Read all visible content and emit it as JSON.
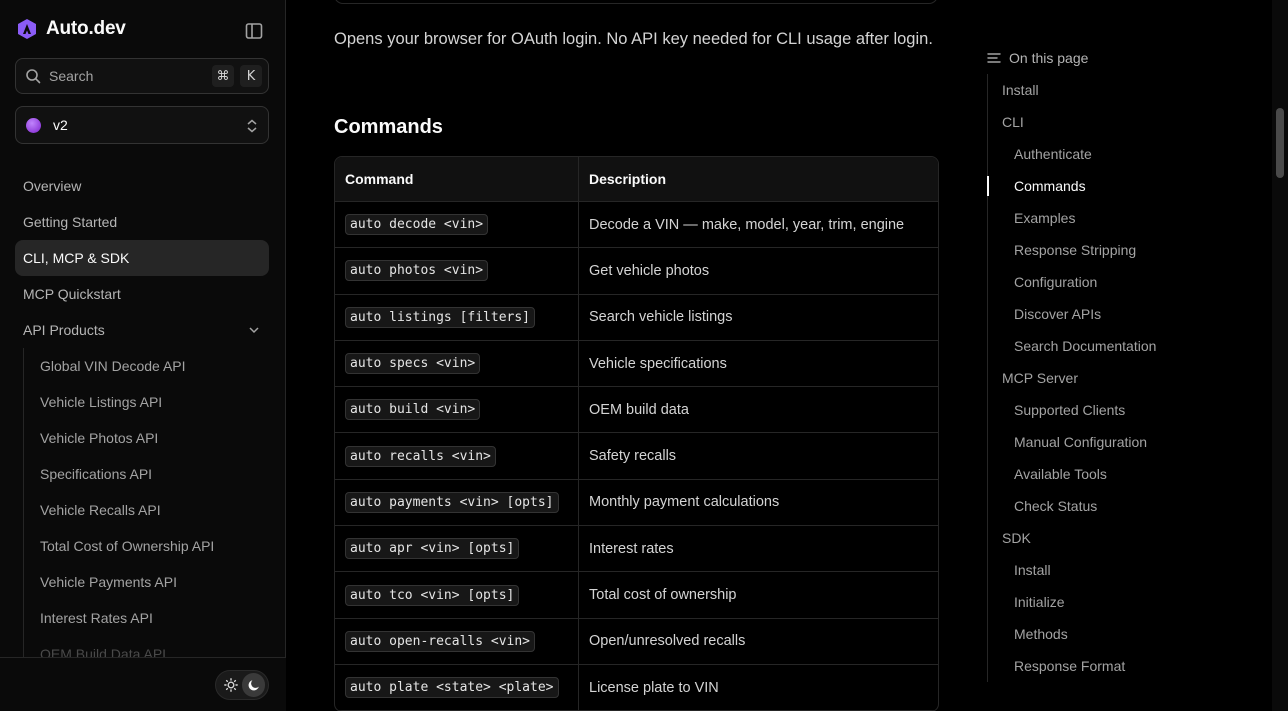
{
  "brand": {
    "name": "Auto.dev",
    "accent": "#8b5cf6"
  },
  "search": {
    "placeholder": "Search",
    "shortcut_mod": "⌘",
    "shortcut_key": "K"
  },
  "version": {
    "label": "v2"
  },
  "nav": {
    "items": [
      {
        "label": "Overview"
      },
      {
        "label": "Getting Started"
      },
      {
        "label": "CLI, MCP & SDK",
        "active": true
      },
      {
        "label": "MCP Quickstart"
      },
      {
        "label": "API Products",
        "expanded": true
      }
    ],
    "sub_items": [
      "Global VIN Decode API",
      "Vehicle Listings API",
      "Vehicle Photos API",
      "Specifications API",
      "Vehicle Recalls API",
      "Total Cost of Ownership API",
      "Vehicle Payments API",
      "Interest Rates API",
      "OEM Build Data API"
    ]
  },
  "content": {
    "paragraph": "Opens your browser for OAuth login. No API key needed for CLI usage after login.",
    "heading": "Commands",
    "table": {
      "headers": [
        "Command",
        "Description"
      ],
      "rows": [
        [
          "auto decode <vin>",
          "Decode a VIN — make, model, year, trim, engine"
        ],
        [
          "auto photos <vin>",
          "Get vehicle photos"
        ],
        [
          "auto listings [filters]",
          "Search vehicle listings"
        ],
        [
          "auto specs <vin>",
          "Vehicle specifications"
        ],
        [
          "auto build <vin>",
          "OEM build data"
        ],
        [
          "auto recalls <vin>",
          "Safety recalls"
        ],
        [
          "auto payments <vin> [opts]",
          "Monthly payment calculations"
        ],
        [
          "auto apr <vin> [opts]",
          "Interest rates"
        ],
        [
          "auto tco <vin> [opts]",
          "Total cost of ownership"
        ],
        [
          "auto open-recalls <vin>",
          "Open/unresolved recalls"
        ],
        [
          "auto plate <state> <plate>",
          "License plate to VIN"
        ]
      ]
    }
  },
  "toc": {
    "title": "On this page",
    "items": [
      {
        "label": "Install",
        "level": 1
      },
      {
        "label": "CLI",
        "level": 1
      },
      {
        "label": "Authenticate",
        "level": 2
      },
      {
        "label": "Commands",
        "level": 2,
        "active": true
      },
      {
        "label": "Examples",
        "level": 2
      },
      {
        "label": "Response Stripping",
        "level": 2
      },
      {
        "label": "Configuration",
        "level": 2
      },
      {
        "label": "Discover APIs",
        "level": 2
      },
      {
        "label": "Search Documentation",
        "level": 2
      },
      {
        "label": "MCP Server",
        "level": 1
      },
      {
        "label": "Supported Clients",
        "level": 2
      },
      {
        "label": "Manual Configuration",
        "level": 2
      },
      {
        "label": "Available Tools",
        "level": 2
      },
      {
        "label": "Check Status",
        "level": 2
      },
      {
        "label": "SDK",
        "level": 1
      },
      {
        "label": "Install",
        "level": 2
      },
      {
        "label": "Initialize",
        "level": 2
      },
      {
        "label": "Methods",
        "level": 2
      },
      {
        "label": "Response Format",
        "level": 2
      }
    ]
  },
  "theme": {
    "mode": "dark"
  }
}
